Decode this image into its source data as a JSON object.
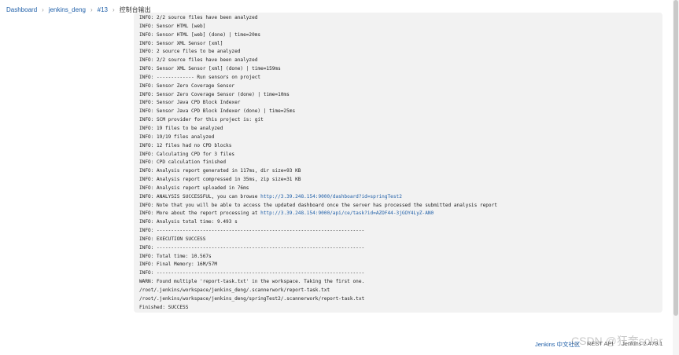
{
  "breadcrumb": {
    "items": [
      "Dashboard",
      "jenkins_deng",
      "#13",
      "控制台输出"
    ]
  },
  "console": {
    "lines": [
      {
        "text": "INFO: 2/2 source files have been analyzed"
      },
      {
        "text": "INFO: Sensor HTML [web]"
      },
      {
        "text": "INFO: Sensor HTML [web] (done) | time=20ms"
      },
      {
        "text": "INFO: Sensor XML Sensor [xml]"
      },
      {
        "text": "INFO: 2 source files to be analyzed"
      },
      {
        "text": "INFO: 2/2 source files have been analyzed"
      },
      {
        "text": "INFO: Sensor XML Sensor [xml] (done) | time=159ms"
      },
      {
        "text": "INFO: ------------- Run sensors on project"
      },
      {
        "text": "INFO: Sensor Zero Coverage Sensor"
      },
      {
        "text": "INFO: Sensor Zero Coverage Sensor (done) | time=10ms"
      },
      {
        "text": "INFO: Sensor Java CPD Block Indexer"
      },
      {
        "text": "INFO: Sensor Java CPD Block Indexer (done) | time=25ms"
      },
      {
        "text": "INFO: SCM provider for this project is: git"
      },
      {
        "text": "INFO: 19 files to be analyzed"
      },
      {
        "text": "INFO: 19/19 files analyzed"
      },
      {
        "text": "INFO: 12 files had no CPD blocks"
      },
      {
        "text": "INFO: Calculating CPD for 3 files"
      },
      {
        "text": "INFO: CPD calculation finished"
      },
      {
        "text": "INFO: Analysis report generated in 117ms, dir size=93 KB"
      },
      {
        "text": "INFO: Analysis report compressed in 35ms, zip size=31 KB"
      },
      {
        "text": "INFO: Analysis report uploaded in 76ms"
      },
      {
        "text": "INFO: ANALYSIS SUCCESSFUL, you can browse ",
        "link": "http://3.39.248.154:9000/dashboard?id=springTest2"
      },
      {
        "text": "INFO: Note that you will be able to access the updated dashboard once the server has processed the submitted analysis report"
      },
      {
        "text": "INFO: More about the report processing at ",
        "link": "http://3.39.248.154:9000/api/ce/task?id=AZOF44-3jGOY4LyZ-AN0"
      },
      {
        "text": "INFO: Analysis total time: 9.493 s"
      },
      {
        "text": "INFO: ------------------------------------------------------------------------"
      },
      {
        "text": "INFO: EXECUTION SUCCESS"
      },
      {
        "text": "INFO: ------------------------------------------------------------------------"
      },
      {
        "text": "INFO: Total time: 10.567s"
      },
      {
        "text": "INFO: Final Memory: 16M/57M"
      },
      {
        "text": "INFO: ------------------------------------------------------------------------"
      },
      {
        "text": "WARN: Found multiple 'report-task.txt' in the workspace. Taking the first one."
      },
      {
        "text": "/root/.jenkins/workspace/jenkins_deng/.scannerwork/report-task.txt"
      },
      {
        "text": "/root/.jenkins/workspace/jenkins_deng/springTest2/.scannerwork/report-task.txt"
      },
      {
        "text": "Finished: SUCCESS"
      }
    ]
  },
  "footer": {
    "community_link": "Jenkins 中文社区",
    "rest_api": "REST API",
    "version": "Jenkins 2.479.1"
  },
  "watermark": "CSDN @狂奔solar"
}
